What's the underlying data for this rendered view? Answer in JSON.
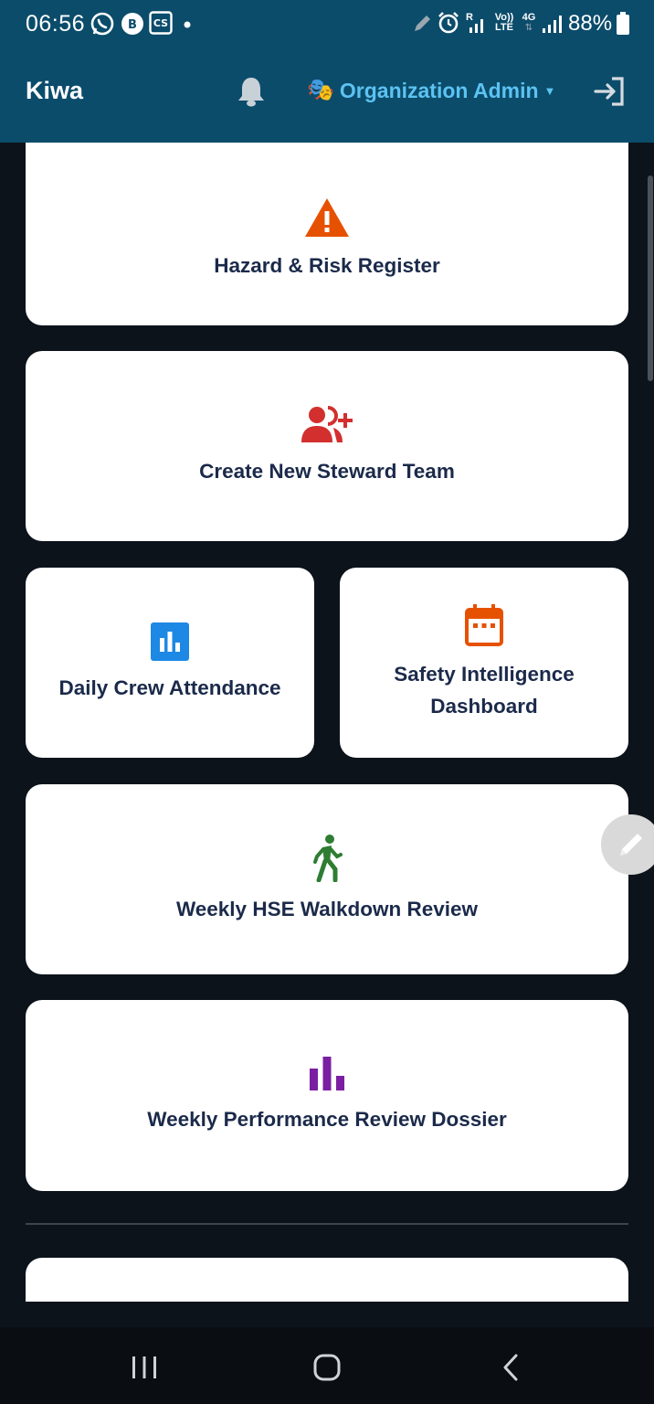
{
  "status_bar": {
    "time": "06:56",
    "battery": "88%",
    "left_icons": [
      "whatsapp-icon",
      "whatsapp-business-icon",
      "camscanner-icon",
      "dot-icon"
    ],
    "right_icons": [
      "pen-icon",
      "alarm-icon",
      "signal-icon",
      "volte-icon",
      "4g-icon",
      "signal-icon",
      "battery-icon"
    ],
    "network_r": "R",
    "volte_top": "Vo))",
    "volte_bottom": "LTE",
    "network_type": "4G"
  },
  "header": {
    "title": "Kiwa",
    "org_emoji": "🎭",
    "org_label": "Organization Admin",
    "org_caret": "▼",
    "icons": [
      "bell-icon",
      "logout-icon"
    ]
  },
  "cards": [
    {
      "label": "Hazard & Risk Register",
      "icon": "warning-icon",
      "color": "#e65100"
    },
    {
      "label": "Create New Steward Team",
      "icon": "add-user-icon",
      "color": "#d32f2f"
    },
    {
      "label": "Daily Crew Attendance",
      "icon": "bar-chart-icon",
      "color": "#1e88e5"
    },
    {
      "label": "Safety Intelligence Dashboard",
      "icon": "calendar-icon",
      "color": "#e65100"
    },
    {
      "label": "Weekly HSE Walkdown Review",
      "icon": "walking-person-icon",
      "color": "#2e7d32"
    },
    {
      "label": "Weekly Performance Review Dossier",
      "icon": "bar-chart-icon",
      "color": "#7b1fa2"
    }
  ],
  "fab": {
    "icon": "pencil-icon"
  },
  "navbar": {
    "icons": [
      "recent-apps-icon",
      "home-icon",
      "back-icon"
    ]
  },
  "colors": {
    "header_bg": "#0b4c6b",
    "page_bg": "#0d131b",
    "card_text": "#1b2a4a",
    "org_text": "#5cc3f2"
  }
}
